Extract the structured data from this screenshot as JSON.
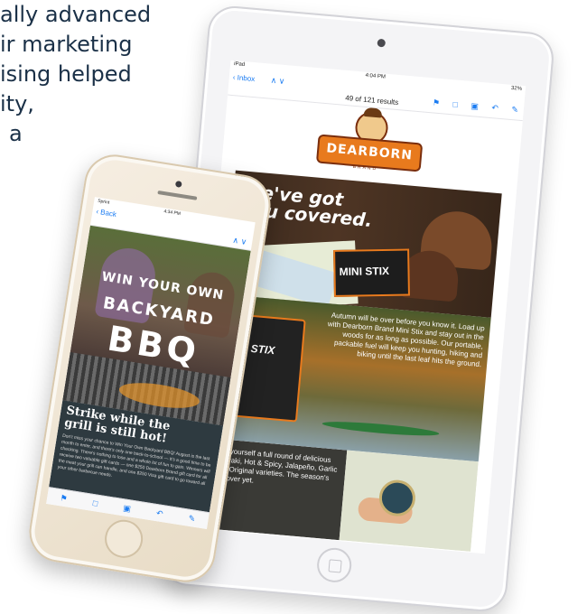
{
  "background_text": [
    "ally advanced",
    "ir marketing",
    "ising helped",
    "ity,",
    "a"
  ],
  "ipad": {
    "status": {
      "carrier": "iPad",
      "time": "4:04 PM",
      "battery": "32%"
    },
    "nav": {
      "back": "Inbox",
      "arrows": "∧  ∨",
      "count": "49 of 121 results"
    },
    "toolbar_icons": [
      "flag-icon",
      "folder-icon",
      "archive-icon",
      "reply-icon",
      "compose-icon"
    ],
    "toolbar_glyphs": [
      "⚑",
      "□",
      "▣",
      "↶",
      "✎"
    ],
    "logo": {
      "name": "DEARBORN",
      "sub": "BRAND"
    },
    "panel1": {
      "headline_1": "We've got",
      "headline_2": "you covered.",
      "product": "MINI STIX"
    },
    "panel2": {
      "copy": "Autumn will be over before you know it. Load up with Dearborn Brand Mini Stix and stay out in the woods for as long as possible. Our portable, packable fuel will keep you hunting, hiking and biking until the last leaf hits the ground.",
      "bag_label": "STIX"
    },
    "panel3": {
      "copy": "Get yourself a full round of delicious Teriyaki, Hot & Spicy, Jalapeño, Garlic and Original varieties. The season's not over yet."
    }
  },
  "iphone": {
    "status": {
      "carrier": "Sprint",
      "time": "4:34 PM"
    },
    "nav": {
      "back": "Back",
      "arrows": "∧  ∨"
    },
    "hero": {
      "line1": "WIN YOUR OWN",
      "line2": "BACKYARD",
      "line3": "BBQ"
    },
    "promo": {
      "headline_1": "Strike while the",
      "headline_2": "grill is still hot!",
      "body": "Don't miss your chance to Win Your Own Backyard BBQ! August is the last month to enter, and there's only one back-to-school — it's a good time to be checking. There's nothing to lose and a whole lot of fun to gain. Winners will receive two valuable gift cards — one $250 Dearborn Brand gift card for all the meat your grill can handle, and one $250 Visa gift card to go toward all your other barbecue needs."
    },
    "toolbar_glyphs": [
      "⚑",
      "□",
      "▣",
      "↶",
      "✎"
    ]
  }
}
